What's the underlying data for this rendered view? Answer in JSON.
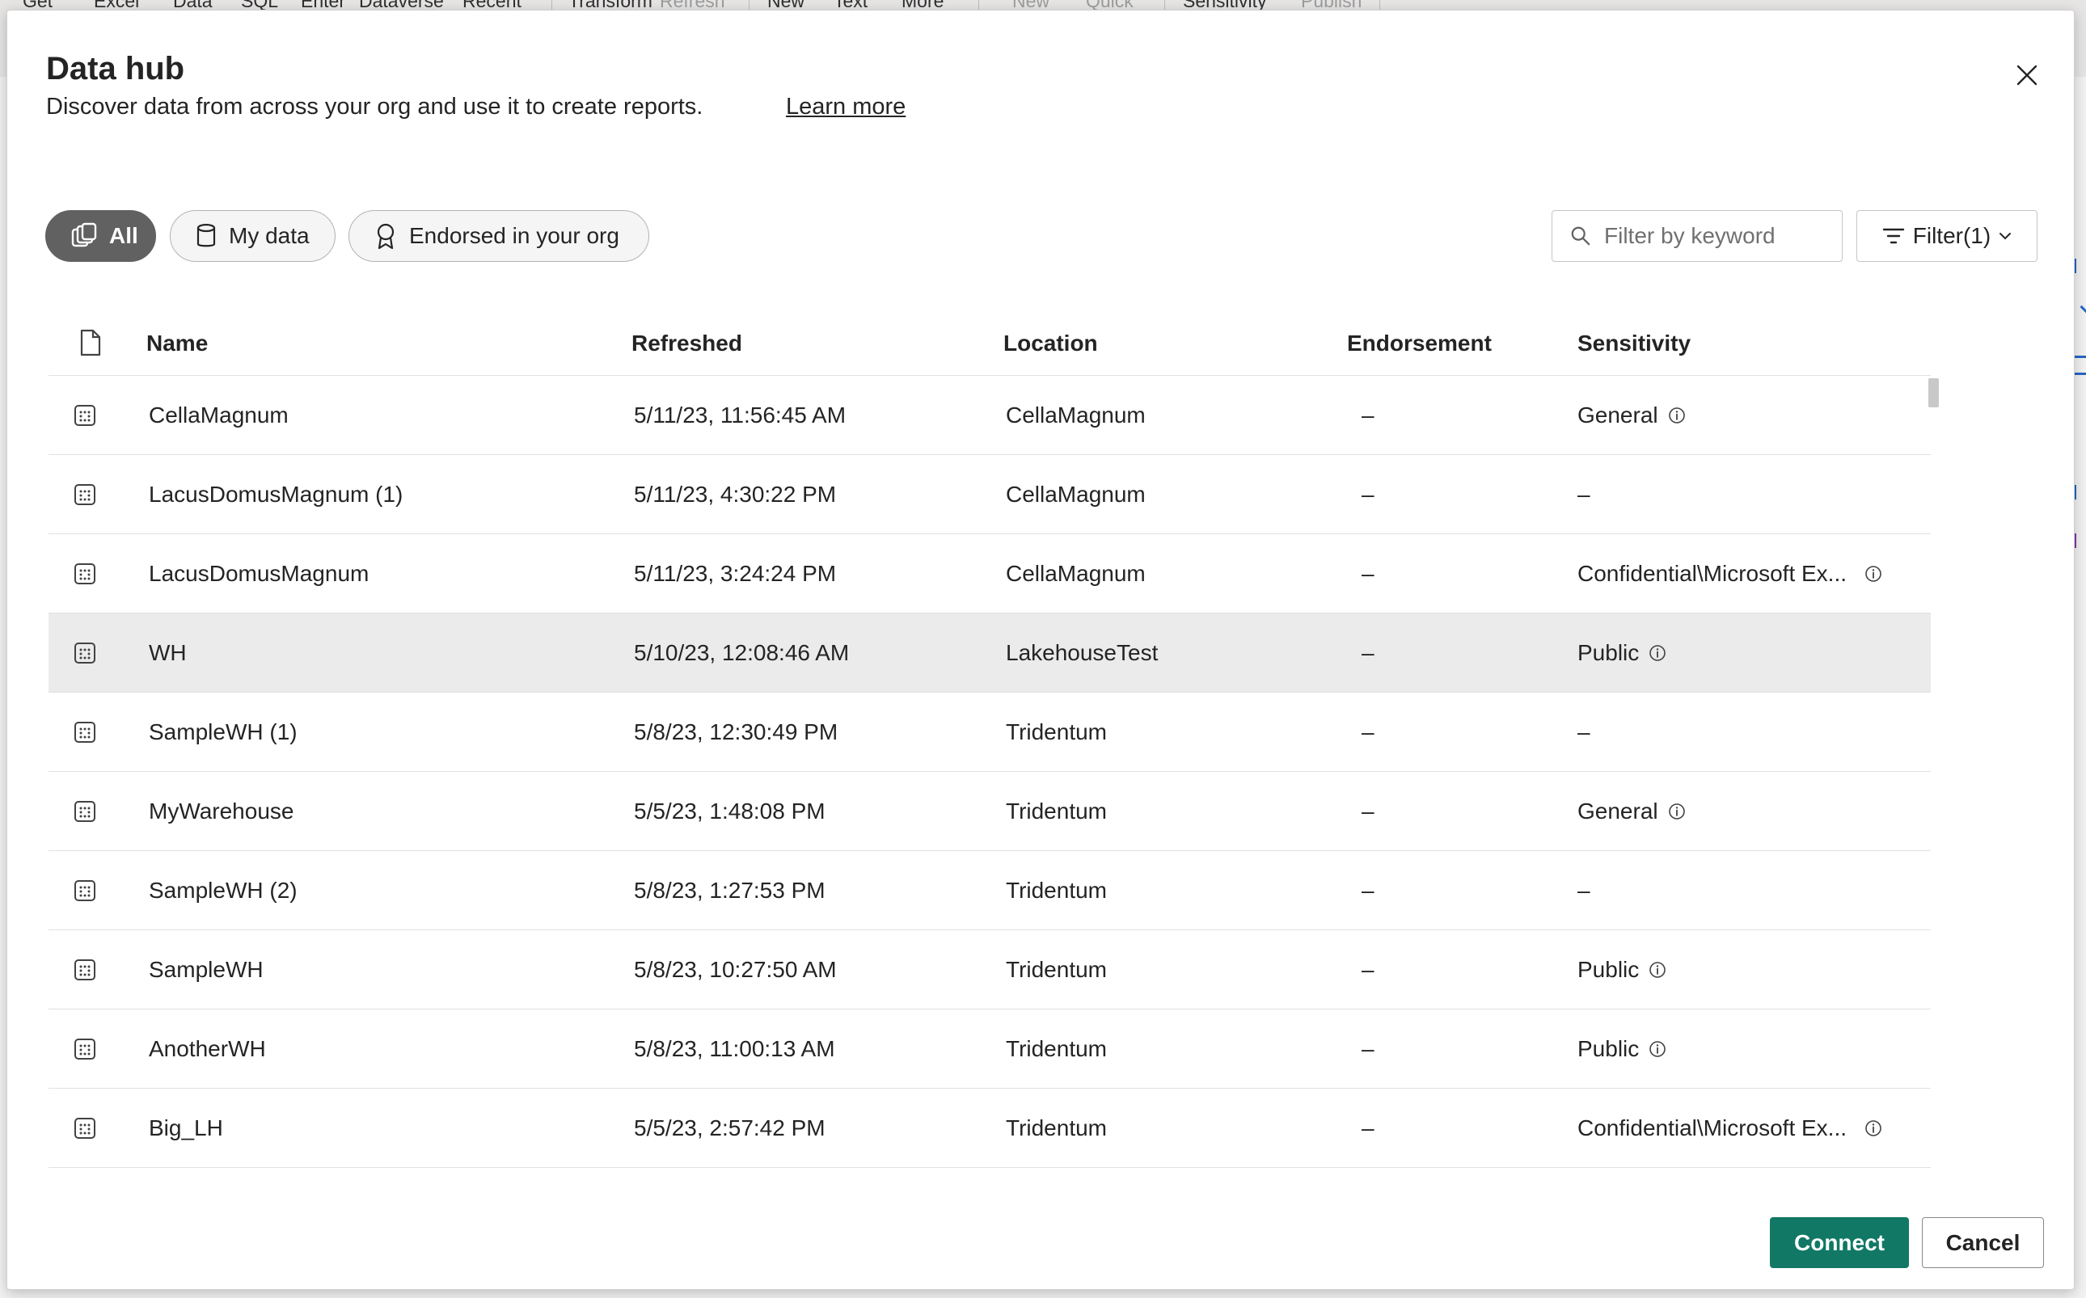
{
  "ribbon": {
    "items": [
      "Get",
      "Excel",
      "Data",
      "SQL",
      "Enter",
      "Dataverse",
      "Recent",
      "Transform",
      "Refresh",
      "New",
      "Text",
      "More",
      "New",
      "Quick",
      "Sensitivity",
      "Publish"
    ]
  },
  "dialog": {
    "title": "Data hub",
    "subtitle": "Discover data from across your org and use it to create reports.",
    "learn_more": "Learn more",
    "close_icon": "close-icon"
  },
  "pills": {
    "all": "All",
    "my_data": "My data",
    "endorsed": "Endorsed in your org"
  },
  "search": {
    "placeholder": "Filter by keyword"
  },
  "filter": {
    "label": "Filter(1)"
  },
  "table": {
    "columns": {
      "name": "Name",
      "refreshed": "Refreshed",
      "location": "Location",
      "endorsement": "Endorsement",
      "sensitivity": "Sensitivity"
    },
    "rows": [
      {
        "name": "CellaMagnum",
        "refreshed": "5/11/23, 11:56:45 AM",
        "location": "CellaMagnum",
        "endorsement": "–",
        "sensitivity": "General",
        "info": true
      },
      {
        "name": "LacusDomusMagnum (1)",
        "refreshed": "5/11/23, 4:30:22 PM",
        "location": "CellaMagnum",
        "endorsement": "–",
        "sensitivity": "–",
        "info": false
      },
      {
        "name": "LacusDomusMagnum",
        "refreshed": "5/11/23, 3:24:24 PM",
        "location": "CellaMagnum",
        "endorsement": "–",
        "sensitivity": "Confidential\\Microsoft Ex...",
        "info": true
      },
      {
        "name": "WH",
        "refreshed": "5/10/23, 12:08:46 AM",
        "location": "LakehouseTest",
        "endorsement": "–",
        "sensitivity": "Public",
        "info": true,
        "selected": true
      },
      {
        "name": "SampleWH (1)",
        "refreshed": "5/8/23, 12:30:49 PM",
        "location": "Tridentum",
        "endorsement": "–",
        "sensitivity": "–",
        "info": false
      },
      {
        "name": "MyWarehouse",
        "refreshed": "5/5/23, 1:48:08 PM",
        "location": "Tridentum",
        "endorsement": "–",
        "sensitivity": "General",
        "info": true
      },
      {
        "name": "SampleWH (2)",
        "refreshed": "5/8/23, 1:27:53 PM",
        "location": "Tridentum",
        "endorsement": "–",
        "sensitivity": "–",
        "info": false
      },
      {
        "name": "SampleWH",
        "refreshed": "5/8/23, 10:27:50 AM",
        "location": "Tridentum",
        "endorsement": "–",
        "sensitivity": "Public",
        "info": true
      },
      {
        "name": "AnotherWH",
        "refreshed": "5/8/23, 11:00:13 AM",
        "location": "Tridentum",
        "endorsement": "–",
        "sensitivity": "Public",
        "info": true
      },
      {
        "name": "Big_LH",
        "refreshed": "5/5/23, 2:57:42 PM",
        "location": "Tridentum",
        "endorsement": "–",
        "sensitivity": "Confidential\\Microsoft Ex...",
        "info": true
      }
    ]
  },
  "footer": {
    "connect": "Connect",
    "cancel": "Cancel"
  },
  "colors": {
    "primary": "#117865",
    "pill_active": "#616161",
    "selected_row": "#ebebeb"
  }
}
